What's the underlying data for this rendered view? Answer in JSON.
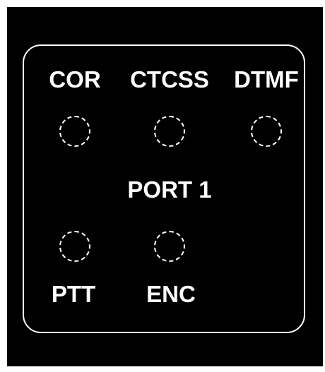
{
  "panel": {
    "labels": {
      "cor": "COR",
      "ctcss": "CTCSS",
      "dtmf": "DTMF",
      "port": "PORT 1",
      "ptt": "PTT",
      "enc": "ENC"
    },
    "colors": {
      "background": "#000000",
      "foreground": "#ffffff"
    },
    "indicators": [
      {
        "name": "COR",
        "state": "off"
      },
      {
        "name": "CTCSS",
        "state": "off"
      },
      {
        "name": "DTMF",
        "state": "off"
      },
      {
        "name": "PTT",
        "state": "off"
      },
      {
        "name": "ENC",
        "state": "off"
      }
    ]
  }
}
